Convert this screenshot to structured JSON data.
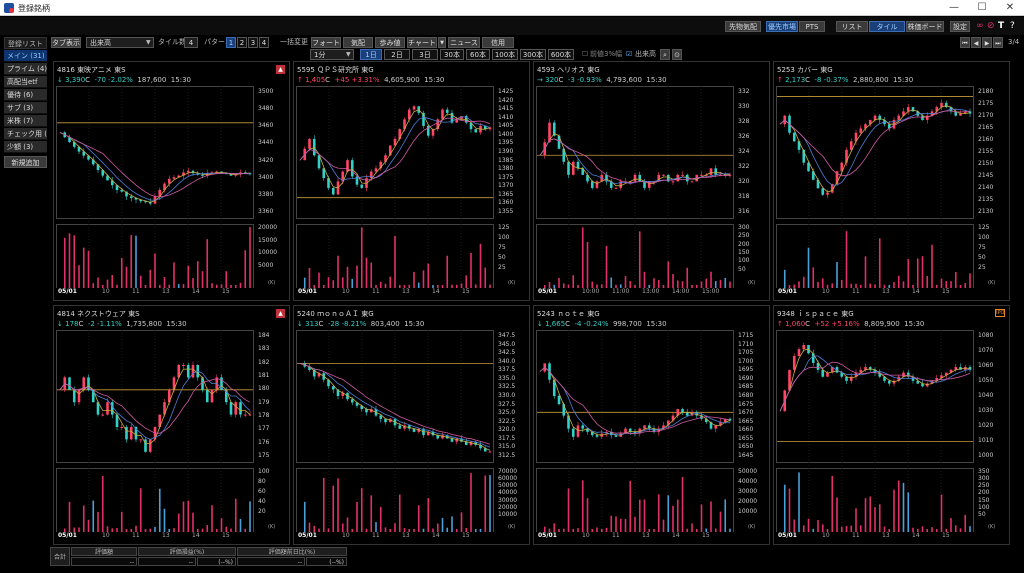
{
  "window": {
    "title": "登録銘柄"
  },
  "top_buttons": {
    "futures": "先物気配",
    "priority": "優先市場",
    "pts": "PTS",
    "list": "リスト",
    "tile": "タイル",
    "board": "株価ボード",
    "settings": "設定"
  },
  "toolbar": {
    "tab_label": "タブ表示",
    "tab_select": "出来高",
    "tile_count_label": "タイル数",
    "tile_count": "4",
    "pattern_label": "パターン",
    "patterns": [
      "1",
      "2",
      "3",
      "4"
    ],
    "bulk_label": "一括変更",
    "buttons": [
      "フォート",
      "気配",
      "歩み値",
      "チャート",
      "ニュース",
      "信用"
    ],
    "interval": "1分",
    "periods": [
      "1日",
      "2日",
      "3日",
      "30本",
      "60本",
      "100本",
      "300本",
      "600本"
    ],
    "opt1": "前値3%幅",
    "opt2": "出来高",
    "page": "3/4"
  },
  "sidebar": {
    "header": "登録リスト",
    "items": [
      "メイン (31)",
      "プライム (4)",
      "高配当etf",
      "優待 (6)",
      "サブ (3)",
      "米株 (7)",
      "チェック用 (",
      "少額 (3)"
    ],
    "add": "新規追加"
  },
  "tiles": [
    {
      "code": "4816",
      "name": "東映アニメ",
      "market": "東S",
      "arrow": "↓",
      "price": "3,390",
      "flag": "C",
      "change": "-70",
      "pct": "-2.02%",
      "volume": "187,600",
      "time": "15:30",
      "dir": "dn",
      "xlabels": [
        "05/01",
        "10",
        "11",
        "13",
        "14",
        "15"
      ],
      "prices": [
        "3500",
        "3480",
        "3460",
        "3440",
        "3420",
        "3400",
        "3380",
        "3360"
      ],
      "vols": [
        "20000",
        "15000",
        "10000",
        "5000"
      ],
      "series": [
        3452,
        3446,
        3440,
        3434,
        3428,
        3423,
        3418,
        3412,
        3405,
        3398,
        3392,
        3386,
        3380,
        3378,
        3372,
        3370,
        3368,
        3366,
        3365,
        3363,
        3372,
        3380,
        3388,
        3394,
        3396,
        3398,
        3402,
        3404,
        3401,
        3399,
        3398,
        3401,
        3402,
        3403,
        3401,
        3400,
        3398,
        3400,
        3402,
        3401,
        3400
      ],
      "pmin": 3350,
      "pmax": 3505,
      "hline": 3464,
      "mark": "alert"
    },
    {
      "code": "5595",
      "name": "ＱＰＳ研究所",
      "market": "東G",
      "arrow": "↑",
      "price": "1,405",
      "flag": "C",
      "change": "+45",
      "pct": "+3.31%",
      "volume": "4,605,900",
      "time": "15:30",
      "dir": "up",
      "xlabels": [
        "05/01",
        "10",
        "11",
        "13",
        "14",
        "15"
      ],
      "prices": [
        "1425",
        "1420",
        "1415",
        "1410",
        "1405",
        "1400",
        "1395",
        "1390",
        "1385",
        "1380",
        "1375",
        "1370",
        "1365",
        "1360",
        "1355"
      ],
      "vols": [
        "125",
        "100",
        "75",
        "50",
        "25"
      ],
      "series": [
        1385,
        1392,
        1398,
        1388,
        1380,
        1374,
        1368,
        1364,
        1372,
        1378,
        1385,
        1375,
        1370,
        1368,
        1374,
        1378,
        1380,
        1384,
        1388,
        1394,
        1398,
        1404,
        1410,
        1416,
        1418,
        1414,
        1406,
        1400,
        1404,
        1410,
        1416,
        1414,
        1408,
        1410,
        1412,
        1408,
        1404,
        1402,
        1406,
        1404,
        1405
      ],
      "pmin": 1352,
      "pmax": 1428,
      "hline": 1362,
      "mark": ""
    },
    {
      "code": "4593",
      "name": "ヘリオス",
      "market": "東G",
      "arrow": "→",
      "price": "320",
      "flag": "C",
      "change": "-3",
      "pct": "-0.93%",
      "volume": "4,793,600",
      "time": "15:30",
      "dir": "dn",
      "xlabels": [
        "05/01",
        "10:00",
        "11:00",
        "13:00",
        "14:00",
        "15:00"
      ],
      "prices": [
        "332",
        "330",
        "328",
        "326",
        "324",
        "322",
        "320",
        "318",
        "316"
      ],
      "vols": [
        "300",
        "250",
        "200",
        "150",
        "100",
        "50"
      ],
      "series": [
        323,
        325,
        328,
        326,
        324,
        322,
        320,
        322,
        321,
        320,
        319,
        318,
        319,
        320,
        319,
        318,
        318,
        319,
        319,
        319,
        320,
        319,
        318,
        319,
        319,
        320,
        320,
        319,
        319,
        320,
        320,
        319,
        319,
        320,
        320,
        320,
        321,
        320,
        320,
        320,
        320
      ],
      "pmin": 314,
      "pmax": 333,
      "hline": 323,
      "mark": ""
    },
    {
      "code": "5253",
      "name": "カバー",
      "market": "東G",
      "arrow": "↑",
      "price": "2,173",
      "flag": "C",
      "change": "-8",
      "pct": "-0.37%",
      "volume": "2,880,800",
      "time": "15:30",
      "dir": "dn",
      "xlabels": [
        "05/01",
        "10",
        "11",
        "13",
        "14",
        "15"
      ],
      "prices": [
        "2180",
        "2175",
        "2170",
        "2165",
        "2160",
        "2155",
        "2150",
        "2145",
        "2140",
        "2135",
        "2130"
      ],
      "vols": [
        "125",
        "100",
        "75",
        "50",
        "25"
      ],
      "series": [
        2168,
        2172,
        2164,
        2160,
        2156,
        2150,
        2146,
        2142,
        2138,
        2135,
        2136,
        2140,
        2146,
        2150,
        2156,
        2160,
        2164,
        2166,
        2168,
        2170,
        2172,
        2170,
        2168,
        2166,
        2170,
        2172,
        2174,
        2176,
        2174,
        2172,
        2170,
        2172,
        2174,
        2176,
        2178,
        2176,
        2174,
        2172,
        2173,
        2174,
        2173
      ],
      "pmin": 2126,
      "pmax": 2184,
      "hline": 2181,
      "mark": ""
    },
    {
      "code": "4814",
      "name": "ネクストウェア",
      "market": "東S",
      "arrow": "↓",
      "price": "178",
      "flag": "C",
      "change": "-2",
      "pct": "-1.11%",
      "volume": "1,735,800",
      "time": "15:30",
      "dir": "dn",
      "xlabels": [
        "05/01",
        "10",
        "11",
        "13",
        "14",
        "15"
      ],
      "prices": [
        "184",
        "183",
        "182",
        "181",
        "180",
        "179",
        "178",
        "177",
        "176",
        "175"
      ],
      "vols": [
        "100",
        "80",
        "60",
        "40",
        "20"
      ],
      "series": [
        180,
        181,
        180,
        179,
        180,
        181,
        180,
        179,
        178,
        178,
        179,
        178,
        177,
        177,
        176,
        177,
        176,
        176,
        175,
        176,
        177,
        178,
        179,
        180,
        181,
        182,
        182,
        181,
        182,
        181,
        180,
        179,
        180,
        181,
        180,
        179,
        178,
        179,
        178,
        178,
        178
      ],
      "pmin": 174.5,
      "pmax": 184.5,
      "hline": 180,
      "mark": "alert"
    },
    {
      "code": "5240",
      "name": "ｍｏｎｏＡＩ",
      "market": "東G",
      "arrow": "↓",
      "price": "313",
      "flag": "C",
      "change": "-28",
      "pct": "-8.21%",
      "volume": "803,400",
      "time": "15:30",
      "dir": "dn",
      "xlabels": [
        "05/01",
        "10",
        "11",
        "13",
        "14",
        "15"
      ],
      "prices": [
        "347.5",
        "345.0",
        "342.5",
        "340.0",
        "337.5",
        "335.0",
        "332.5",
        "330.0",
        "327.5",
        "325.0",
        "322.5",
        "320.0",
        "317.5",
        "315.0",
        "312.5"
      ],
      "vols": [
        "70000",
        "60000",
        "50000",
        "40000",
        "30000",
        "20000",
        "10000"
      ],
      "series": [
        340,
        339,
        338,
        336,
        337,
        335,
        333,
        332,
        330,
        331,
        329,
        328,
        327,
        326,
        325,
        326,
        324,
        323,
        322,
        323,
        321,
        320,
        321,
        320,
        319,
        320,
        318,
        319,
        318,
        317,
        318,
        317,
        316,
        317,
        316,
        315,
        316,
        315,
        314,
        313,
        313
      ],
      "pmin": 311,
      "pmax": 349,
      "hline": 340,
      "mark": ""
    },
    {
      "code": "5243",
      "name": "ｎｏｔｅ",
      "market": "東G",
      "arrow": "↓",
      "price": "1,665",
      "flag": "C",
      "change": "-4",
      "pct": "-0.24%",
      "volume": "998,700",
      "time": "15:30",
      "dir": "dn",
      "xlabels": [
        "05/01",
        "10",
        "11",
        "13",
        "14",
        "15"
      ],
      "prices": [
        "1715",
        "1710",
        "1705",
        "1700",
        "1695",
        "1690",
        "1685",
        "1680",
        "1675",
        "1670",
        "1665",
        "1660",
        "1655",
        "1650",
        "1645"
      ],
      "vols": [
        "50000",
        "40000",
        "30000",
        "20000",
        "10000"
      ],
      "series": [
        1695,
        1700,
        1690,
        1680,
        1675,
        1668,
        1660,
        1655,
        1662,
        1660,
        1658,
        1656,
        1655,
        1657,
        1658,
        1656,
        1655,
        1657,
        1660,
        1658,
        1657,
        1660,
        1662,
        1660,
        1658,
        1660,
        1662,
        1665,
        1668,
        1672,
        1670,
        1668,
        1670,
        1668,
        1666,
        1664,
        1660,
        1662,
        1664,
        1666,
        1665
      ],
      "pmin": 1642,
      "pmax": 1718,
      "hline": 1670,
      "mark": ""
    },
    {
      "code": "9348",
      "name": "ｉｓｐａｃｅ",
      "market": "東G",
      "arrow": "↑",
      "price": "1,060",
      "flag": "C",
      "change": "+52",
      "pct": "+5.16%",
      "volume": "8,809,900",
      "time": "15:30",
      "dir": "up",
      "xlabels": [
        "05/01",
        "10",
        "11",
        "13",
        "14",
        "15"
      ],
      "prices": [
        "1080",
        "1070",
        "1060",
        "1050",
        "1040",
        "1030",
        "1020",
        "1010",
        "1000"
      ],
      "vols": [
        "350",
        "300",
        "250",
        "200",
        "150",
        "100",
        "50"
      ],
      "series": [
        1030,
        1045,
        1060,
        1070,
        1075,
        1078,
        1072,
        1065,
        1060,
        1055,
        1058,
        1062,
        1058,
        1055,
        1052,
        1055,
        1058,
        1060,
        1062,
        1060,
        1058,
        1055,
        1052,
        1050,
        1052,
        1055,
        1058,
        1055,
        1052,
        1050,
        1048,
        1050,
        1052,
        1054,
        1056,
        1058,
        1060,
        1062,
        1060,
        1062,
        1060
      ],
      "pmin": 996,
      "pmax": 1086,
      "hline": 1008,
      "mark": "badge"
    }
  ],
  "summary": {
    "label": "合計",
    "headers": [
      "評価額",
      "評価損益(%)",
      "評価額前日比(%)"
    ],
    "values": [
      "--",
      "--",
      "(--%)",
      "--",
      "(--%)"
    ]
  },
  "colors": {
    "up": "#ff4466",
    "down": "#33d0c8",
    "ma1": "#c8b040",
    "ma2": "#4e7fd8",
    "ma3": "#d05aa0",
    "hline": "#c89c3c",
    "volume": "#e0306a"
  }
}
